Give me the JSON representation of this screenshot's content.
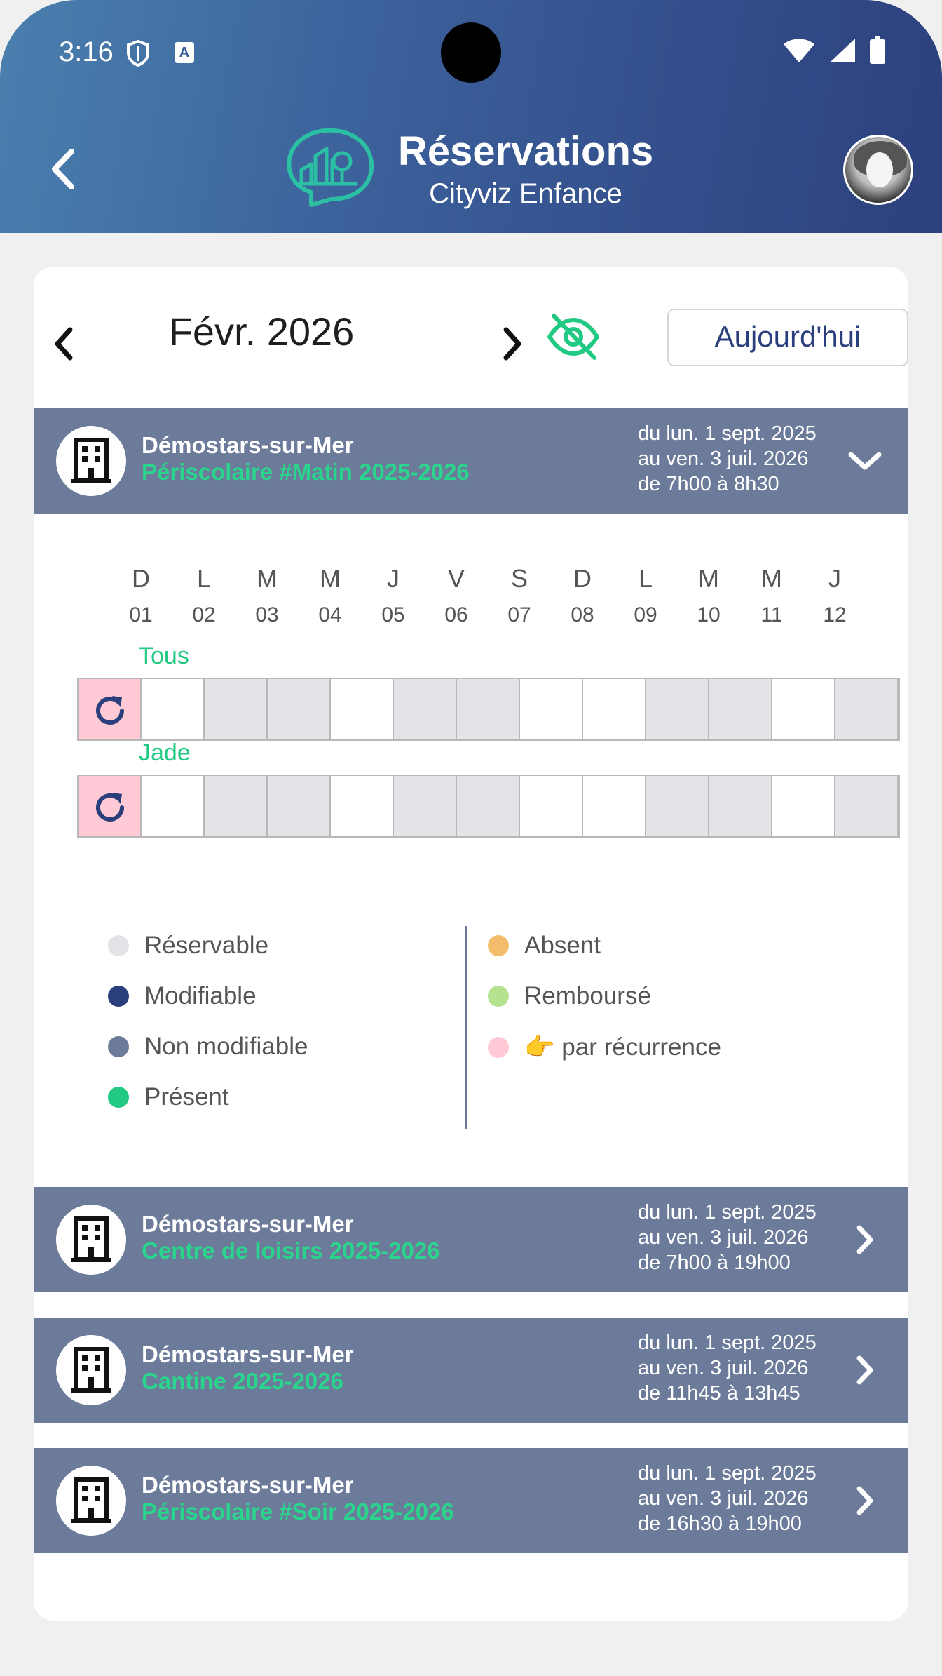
{
  "status": {
    "time": "3:16"
  },
  "header": {
    "title": "Réservations",
    "subtitle": "Cityviz Enfance"
  },
  "calendar": {
    "month": "Févr. 2026",
    "today_label": "Aujourd'hui"
  },
  "services": [
    {
      "city": "Démostars-sur-Mer",
      "name": "Périscolaire #Matin 2025-2026",
      "dates": [
        "du lun. 1 sept. 2025",
        "au ven. 3 juil. 2026",
        "de 7h00 à 8h30"
      ],
      "expanded": true
    },
    {
      "city": "Démostars-sur-Mer",
      "name": "Centre de loisirs 2025-2026",
      "dates": [
        "du lun. 1 sept. 2025",
        "au ven. 3 juil. 2026",
        "de 7h00 à 19h00"
      ],
      "expanded": false
    },
    {
      "city": "Démostars-sur-Mer",
      "name": "Cantine 2025-2026",
      "dates": [
        "du lun. 1 sept. 2025",
        "au ven. 3 juil. 2026",
        "de 11h45 à 13h45"
      ],
      "expanded": false
    },
    {
      "city": "Démostars-sur-Mer",
      "name": "Périscolaire #Soir 2025-2026",
      "dates": [
        "du lun. 1 sept. 2025",
        "au ven. 3 juil. 2026",
        "de 16h30 à 19h00"
      ],
      "expanded": false
    }
  ],
  "days": [
    {
      "letter": "D",
      "num": "01"
    },
    {
      "letter": "L",
      "num": "02"
    },
    {
      "letter": "M",
      "num": "03"
    },
    {
      "letter": "M",
      "num": "04"
    },
    {
      "letter": "J",
      "num": "05"
    },
    {
      "letter": "V",
      "num": "06"
    },
    {
      "letter": "S",
      "num": "07"
    },
    {
      "letter": "D",
      "num": "08"
    },
    {
      "letter": "L",
      "num": "09"
    },
    {
      "letter": "M",
      "num": "10"
    },
    {
      "letter": "M",
      "num": "11"
    },
    {
      "letter": "J",
      "num": "12"
    }
  ],
  "rows": [
    {
      "label": "Tous",
      "cells": [
        "white",
        "gray",
        "gray",
        "white",
        "gray",
        "gray",
        "white",
        "white",
        "gray",
        "gray",
        "white",
        "gray"
      ]
    },
    {
      "label": "Jade",
      "cells": [
        "white",
        "gray",
        "gray",
        "white",
        "gray",
        "gray",
        "white",
        "white",
        "gray",
        "gray",
        "white",
        "gray"
      ]
    }
  ],
  "legend": {
    "left": [
      {
        "label": "Réservable",
        "color": "#e3e4e8"
      },
      {
        "label": "Modifiable",
        "color": "#2b3f7d"
      },
      {
        "label": "Non modifiable",
        "color": "#6c7b9a"
      },
      {
        "label": "Présent",
        "color": "#22c983"
      }
    ],
    "right": [
      {
        "label": "Absent",
        "color": "#f3bd6b"
      },
      {
        "label": "Remboursé",
        "color": "#b5e28f"
      },
      {
        "label": "👉 par récurrence",
        "color": "#ffc9d6"
      }
    ]
  },
  "colors": {
    "accent_green": "#22c983",
    "navy": "#2b3f7d",
    "service_bar": "#6c7b9a",
    "recurrence": "#ffc9d6"
  }
}
